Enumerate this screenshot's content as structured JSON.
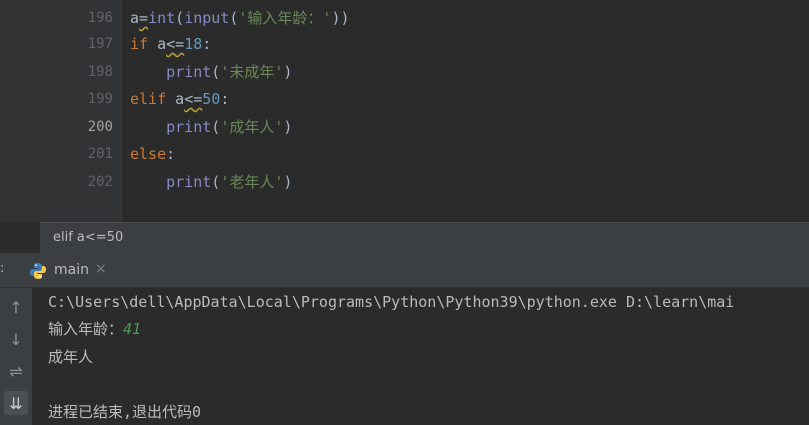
{
  "editor": {
    "gutter": [
      "196",
      "197",
      "198",
      "199",
      "200",
      "201",
      "202"
    ],
    "current_line": "200",
    "lines": [
      [
        {
          "t": "a",
          "c": "id"
        },
        {
          "t": "=",
          "c": "op-squig"
        },
        {
          "t": "int",
          "c": "fn"
        },
        {
          "t": "(",
          "c": "op"
        },
        {
          "t": "input",
          "c": "fn"
        },
        {
          "t": "(",
          "c": "op"
        },
        {
          "t": "'输入年龄：'",
          "c": "str"
        },
        {
          "t": "))",
          "c": "op"
        }
      ],
      [
        {
          "t": "if",
          "c": "kw"
        },
        {
          "t": " a",
          "c": "id"
        },
        {
          "t": "<=",
          "c": "op-squig"
        },
        {
          "t": "18",
          "c": "num"
        },
        {
          "t": ":",
          "c": "op"
        }
      ],
      [
        {
          "t": "    ",
          "c": "ws"
        },
        {
          "t": "print",
          "c": "fn"
        },
        {
          "t": "(",
          "c": "op"
        },
        {
          "t": "'未成年'",
          "c": "str"
        },
        {
          "t": ")",
          "c": "op"
        }
      ],
      [
        {
          "t": "elif",
          "c": "kw"
        },
        {
          "t": " a",
          "c": "id"
        },
        {
          "t": "<=",
          "c": "op-squig"
        },
        {
          "t": "50",
          "c": "num"
        },
        {
          "t": ":",
          "c": "op"
        }
      ],
      [
        {
          "t": "    ",
          "c": "ws"
        },
        {
          "t": "print",
          "c": "fn"
        },
        {
          "t": "(",
          "c": "op"
        },
        {
          "t": "'成年人'",
          "c": "str"
        },
        {
          "t": ")",
          "c": "op"
        }
      ],
      [
        {
          "t": "else",
          "c": "kw"
        },
        {
          "t": ":",
          "c": "op"
        }
      ],
      [
        {
          "t": "    ",
          "c": "ws"
        },
        {
          "t": "print",
          "c": "fn"
        },
        {
          "t": "(",
          "c": "op"
        },
        {
          "t": "'老年人'",
          "c": "str"
        },
        {
          "t": ")",
          "c": "op"
        }
      ]
    ]
  },
  "breadcrumb": {
    "text": "elif a<=50"
  },
  "run_panel": {
    "prefix": ":",
    "tab_label": "main",
    "tab_close": "×",
    "toolbar_icons": [
      "up-arrow-icon",
      "down-arrow-icon",
      "soft-wrap-icon",
      "scroll-to-end-icon"
    ],
    "toolbar_glyphs": [
      "↑",
      "↓",
      "⇌",
      "⇊"
    ]
  },
  "console": {
    "command": "C:\\Users\\dell\\AppData\\Local\\Programs\\Python\\Python39\\python.exe D:\\learn\\mai",
    "prompt": "输入年龄：",
    "user_input": "41",
    "output": "成年人",
    "exit_message": "进程已结束,退出代码0"
  },
  "colors": {
    "keyword": "#cc7832",
    "builtin": "#8888c6",
    "number": "#6897bb",
    "string": "#6a8759",
    "identifier": "#a9b7c6",
    "console_input": "#499c54"
  }
}
